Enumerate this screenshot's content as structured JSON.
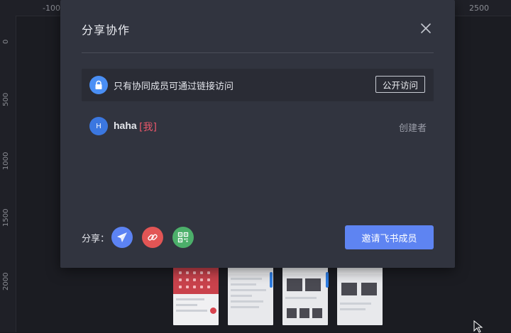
{
  "background": {
    "ruler_top_labels": [
      "-1000",
      "2500"
    ],
    "ruler_left_labels": [
      "0",
      "500",
      "1000",
      "1500",
      "2000"
    ]
  },
  "modal": {
    "title": "分享协作",
    "access": {
      "text": "只有协同成员可通过链接访问",
      "public_button": "公开访问"
    },
    "member": {
      "avatar_initial": "H",
      "name": "haha",
      "me_tag": "[我]",
      "role": "创建者"
    },
    "share": {
      "label": "分享：",
      "icons": [
        "paper-plane-icon",
        "link-icon",
        "qr-code-icon"
      ]
    },
    "invite_button": "邀请飞书成员"
  },
  "colors": {
    "modal_bg": "#31343f",
    "accent_blue": "#5e84f2",
    "lock_blue": "#4a8ff5",
    "link_red": "#e25555",
    "qr_green": "#4caf6a",
    "me_red": "#e9576a"
  }
}
